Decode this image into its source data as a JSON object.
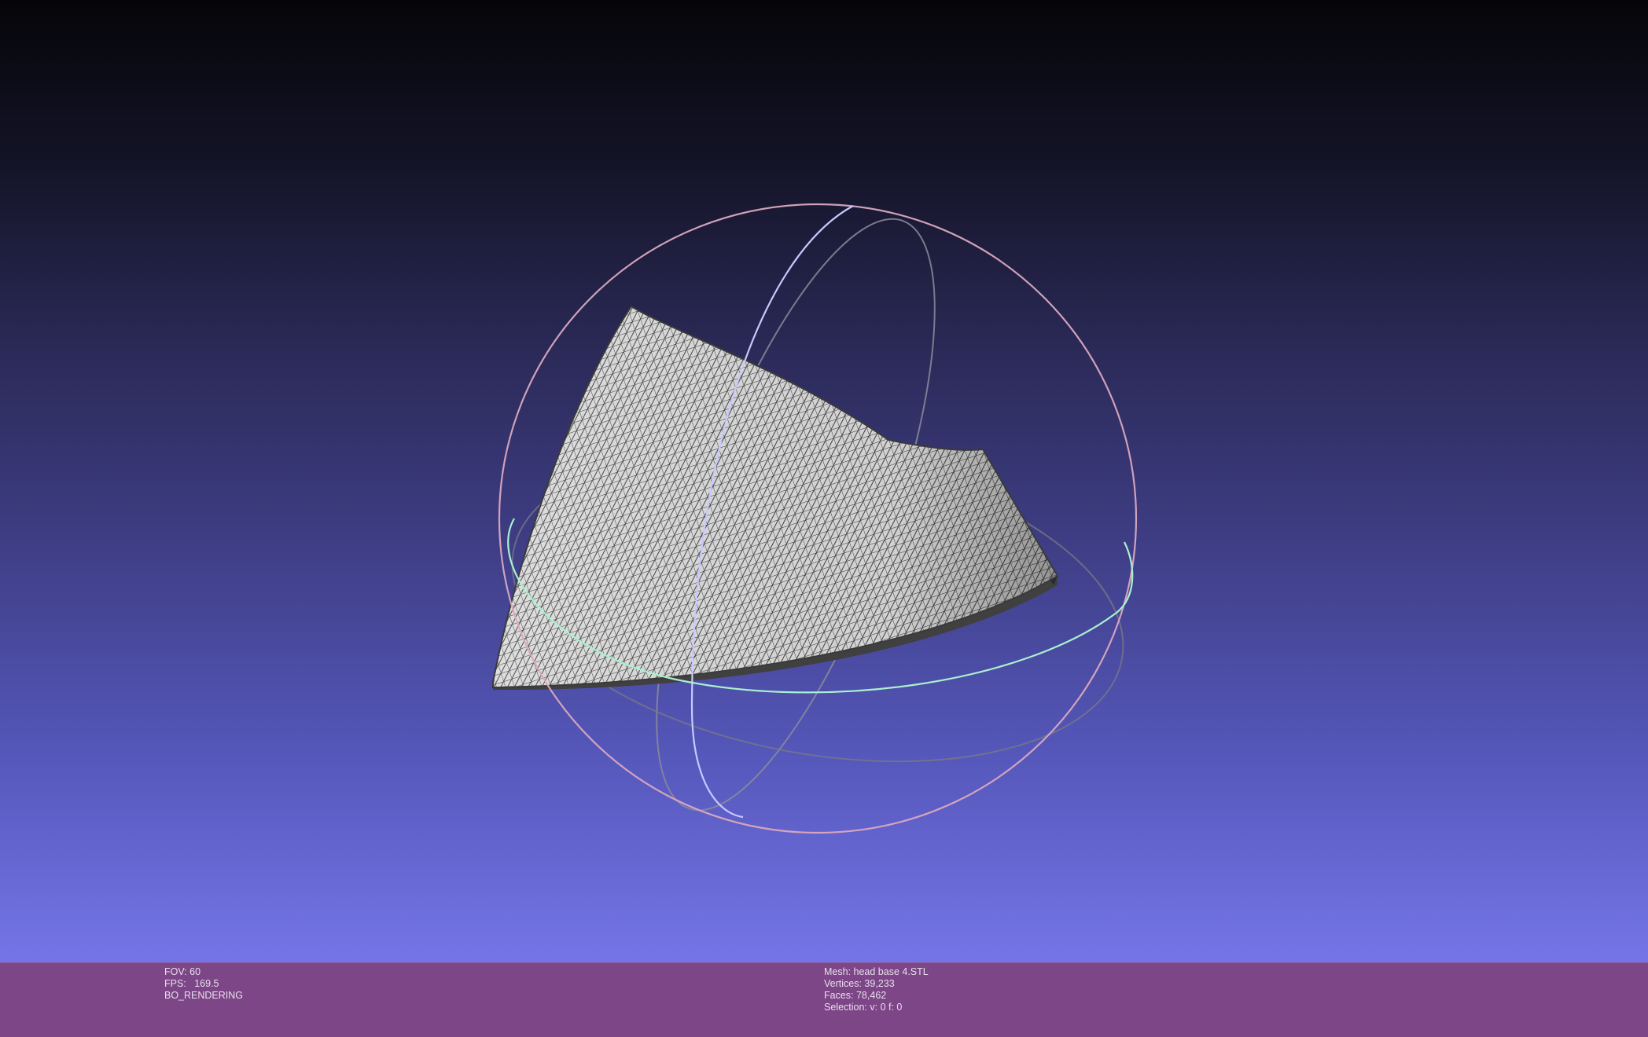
{
  "viewer": {
    "background_top": "#050509",
    "background_bottom": "#7a7aec",
    "mesh_fill": "#d9d9d9",
    "mesh_wire": "#3a3a3a",
    "trackball_colors": {
      "x_ring": "#b9b9ff",
      "y_ring": "#9dffc0",
      "z_ring": "#ffb3b3"
    }
  },
  "info_bar": {
    "color": "#7d4686",
    "render": {
      "fov": "FOV: 60",
      "fps": "FPS:   169.5",
      "mode": "BO_RENDERING"
    },
    "mesh": {
      "name": "Mesh: head base 4.STL",
      "vertices": "Vertices: 39,233",
      "faces": "Faces: 78,462",
      "selection": "Selection: v: 0 f: 0"
    }
  }
}
